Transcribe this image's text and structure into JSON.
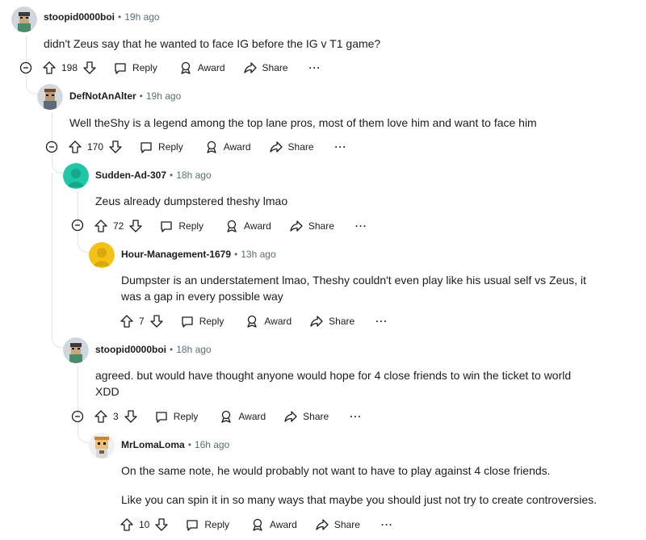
{
  "comments": [
    {
      "author": "stoopid0000boi",
      "dot": "•",
      "time": "19h ago",
      "body": [
        "didn't Zeus say that he wanted to face IG before the IG v T1 game?"
      ],
      "votes": "198",
      "reply": "Reply",
      "award": "Award",
      "share": "Share",
      "more": "···"
    },
    {
      "author": "DefNotAnAlter",
      "dot": "•",
      "time": "19h ago",
      "body": [
        "Well theShy is a legend among the top lane pros, most of them love him and want to face him"
      ],
      "votes": "170",
      "reply": "Reply",
      "award": "Award",
      "share": "Share",
      "more": "···"
    },
    {
      "author": "Sudden-Ad-307",
      "dot": "•",
      "time": "18h ago",
      "body": [
        "Zeus already dumpstered theshy lmao"
      ],
      "votes": "72",
      "reply": "Reply",
      "award": "Award",
      "share": "Share",
      "more": "···"
    },
    {
      "author": "Hour-Management-1679",
      "dot": "•",
      "time": "13h ago",
      "body": [
        "Dumpster is an understatement lmao, Theshy couldn't even play like his usual self vs Zeus, it was a gap in every possible way"
      ],
      "votes": "7",
      "reply": "Reply",
      "award": "Award",
      "share": "Share",
      "more": "···"
    },
    {
      "author": "stoopid0000boi",
      "dot": "•",
      "time": "18h ago",
      "body": [
        "agreed. but would have thought anyone would hope for 4 close friends to win the ticket to world XDD"
      ],
      "votes": "3",
      "reply": "Reply",
      "award": "Award",
      "share": "Share",
      "more": "···"
    },
    {
      "author": "MrLomaLoma",
      "dot": "•",
      "time": "16h ago",
      "body": [
        "On the same note, he would probably not want to have to play against 4 close friends.",
        "Like you can spin it in so many ways that maybe you should just not try to create controversies."
      ],
      "votes": "10",
      "reply": "Reply",
      "award": "Award",
      "share": "Share",
      "more": "···"
    }
  ],
  "icons": {
    "upvote": "upvote-icon",
    "downvote": "downvote-icon",
    "reply": "reply-icon",
    "award": "award-icon",
    "share": "share-icon",
    "collapse": "collapse-icon"
  },
  "colors": {
    "meta": "#576f76",
    "line": "#e1e3e6",
    "sudden_avatar": "#1fc7a6",
    "hour_avatar": "#f2c316"
  }
}
